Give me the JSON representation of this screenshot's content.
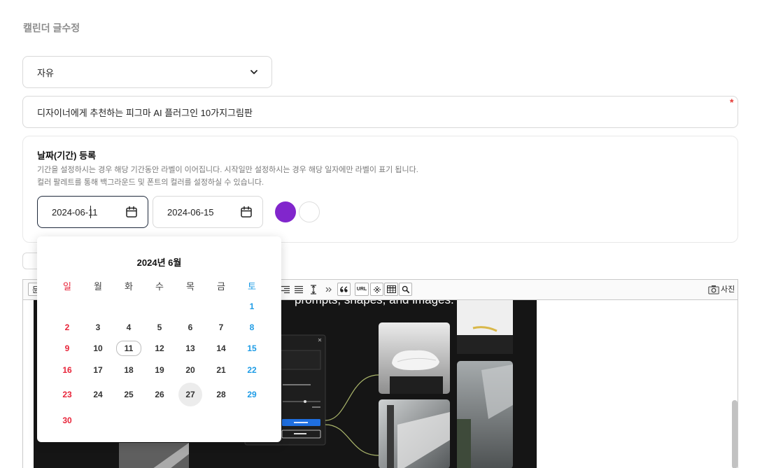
{
  "page": {
    "title": "캘린더 글수정"
  },
  "category": {
    "value": "자유"
  },
  "post_title": {
    "value": "디자이너에게 추천하는 피그마 AI 플러그인 10가지그림판",
    "required_mark": "*"
  },
  "date_section": {
    "heading": "날짜(기간) 등록",
    "desc_lines": [
      "기간을 설정하시는 경우 해당 기간동안 라벨이 이어집니다. 시작일만 설정하시는 경우 해당 일자에만 라벨이 표기 됩니다.",
      "컬러 팔레트를 통해 백그라운드 및 폰트의 컬러를 설정하실 수 있습니다."
    ],
    "start_date": "2024-06-11",
    "end_date": "2024-06-15",
    "colors": {
      "background": "#8126cc",
      "font": "#ffffff"
    }
  },
  "calendar": {
    "month_title": "2024년 6월",
    "weekdays": [
      "일",
      "월",
      "화",
      "수",
      "목",
      "금",
      "토"
    ],
    "weeks": [
      [
        null,
        null,
        null,
        null,
        null,
        null,
        1
      ],
      [
        2,
        3,
        4,
        5,
        6,
        7,
        8
      ],
      [
        9,
        10,
        11,
        12,
        13,
        14,
        15
      ],
      [
        16,
        17,
        18,
        19,
        20,
        21,
        22
      ],
      [
        23,
        24,
        25,
        26,
        27,
        28,
        29
      ],
      [
        30,
        null,
        null,
        null,
        null,
        null,
        null
      ]
    ],
    "outlined_day": 11,
    "highlighted_day": 27,
    "colors": {
      "sunday": "#e8253a",
      "saturday": "#1e9ce6",
      "weekday": "#333333"
    }
  },
  "editor": {
    "toolbar": {
      "paragraph_label": "문",
      "url_label": "URL",
      "photo_label": "사진",
      "icons": [
        "align-right-icon",
        "justify-icon",
        "line-height-icon",
        "more-tools-icon",
        "quote-icon",
        "special-char-icon",
        "table-icon",
        "search-icon",
        "camera-icon"
      ]
    },
    "image": {
      "caption_text": "prompts, shapes, and images."
    }
  }
}
